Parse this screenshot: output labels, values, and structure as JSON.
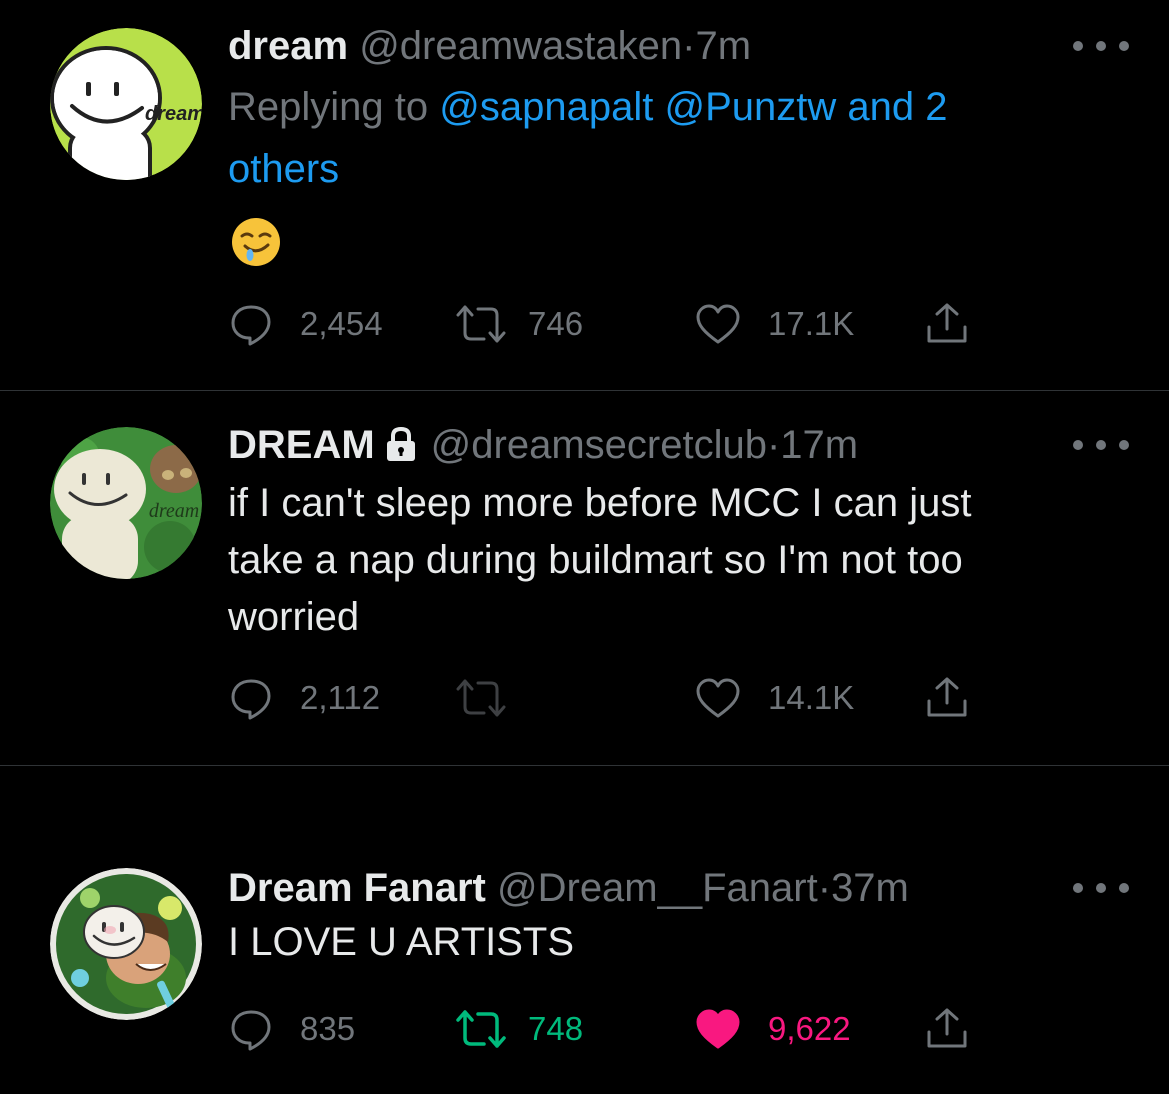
{
  "tweets": [
    {
      "name": "dream",
      "handle": "@dreamwastaken",
      "separator": "·",
      "time": "7m",
      "replying_prefix": "Replying to",
      "mentions": [
        "@sapnapalt",
        "@Punztw",
        "and 2",
        "others"
      ],
      "emoji": "🤤",
      "avatar_label": "dream",
      "avatar_bg": "#b8e04a",
      "stats": {
        "replies": "2,454",
        "retweets": "746",
        "likes": "17.1K"
      }
    },
    {
      "name": "DREAM",
      "handle": "@dreamsecretclub",
      "separator": "·",
      "time": "17m",
      "protected": true,
      "text": "if I can't sleep more before MCC I can just take a nap during buildmart so I'm not too worried",
      "text_lines": [
        "if I can't sleep more before MCC I can just",
        "take a nap during buildmart so I'm not too",
        "worried"
      ],
      "avatar_label": "dream",
      "avatar_bg": "#3f8d3a",
      "stats": {
        "replies": "2,112",
        "retweets": "",
        "likes": "14.1K"
      }
    },
    {
      "name": "Dream Fanart",
      "handle": "@Dream__Fanart",
      "separator": "·",
      "time": "37m",
      "text": "I LOVE U ARTISTS",
      "avatar_bg": "#2f6a2c",
      "stats": {
        "replies": "835",
        "retweets": "748",
        "likes": "9,622",
        "retweeted": true,
        "liked": true
      }
    }
  ],
  "colors": {
    "background": "#000000",
    "primary_text": "#e7e9ea",
    "secondary_text": "#71767b",
    "link": "#1d9bf0",
    "retweet_active": "#00ba7c",
    "like_active": "#f91880",
    "divider": "#2f3336"
  },
  "icons": {
    "reply": "reply-icon",
    "retweet": "retweet-icon",
    "like": "heart-icon",
    "share": "share-icon",
    "more": "more-options-icon",
    "lock": "lock-icon"
  }
}
